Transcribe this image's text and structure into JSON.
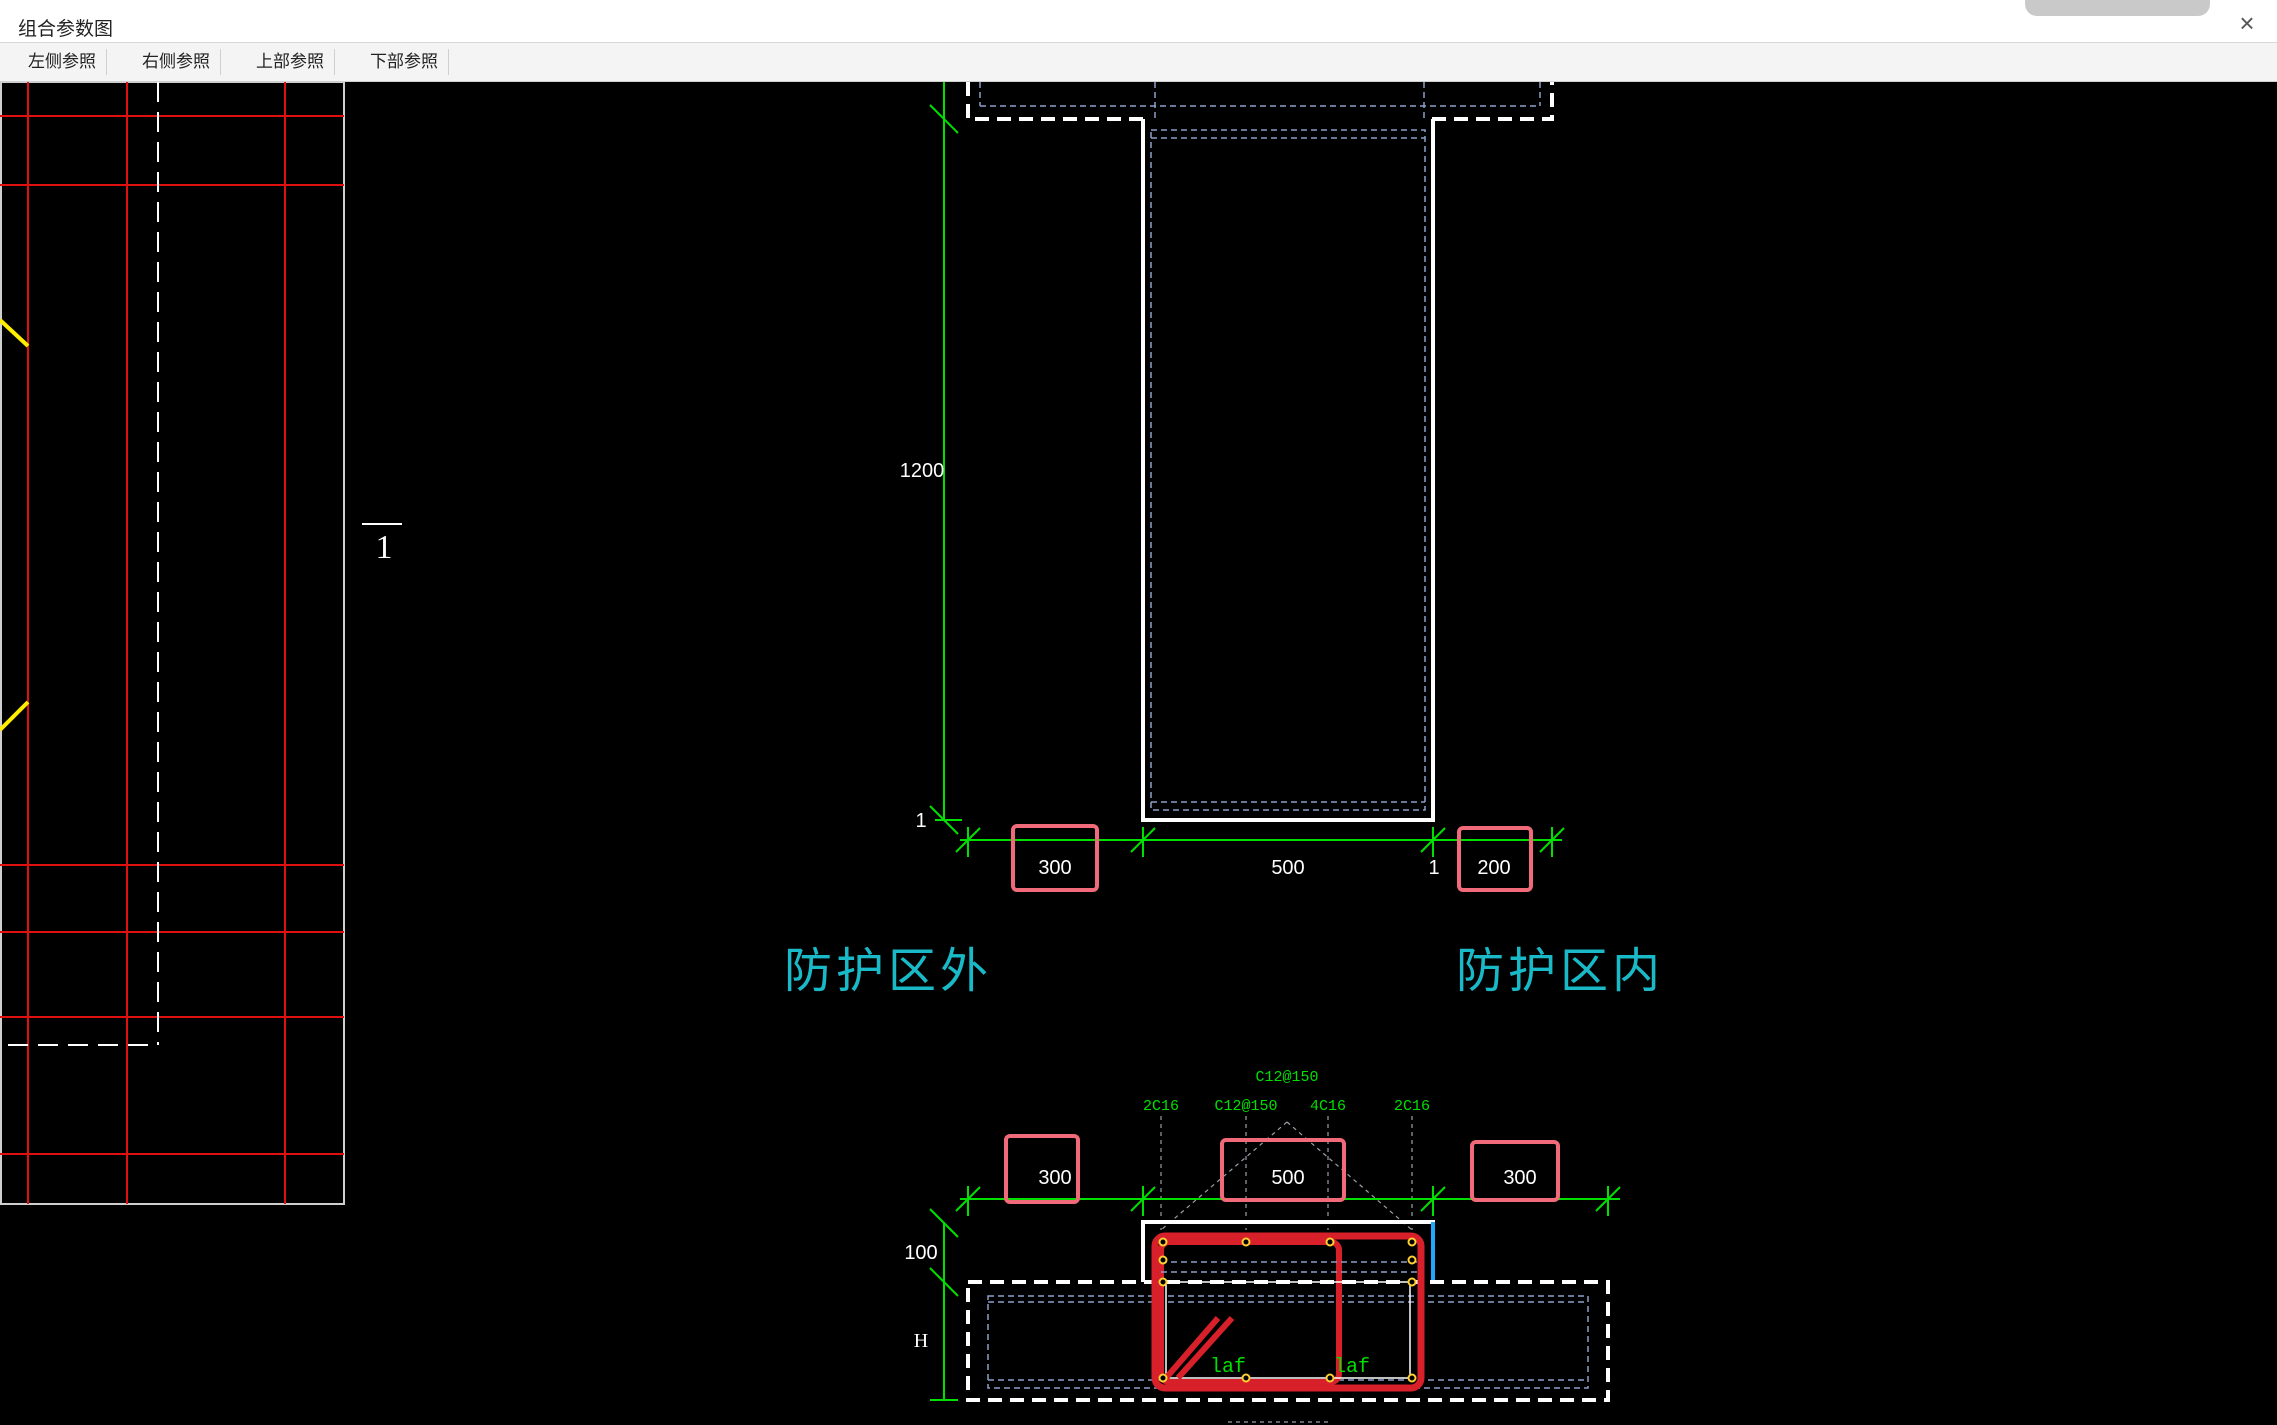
{
  "window": {
    "title": "组合参数图",
    "close_label": "×"
  },
  "toolbar": {
    "buttons": [
      "左侧参照",
      "右侧参照",
      "上部参照",
      "下部参照"
    ]
  },
  "drawing": {
    "section_mark": "1",
    "elevation": {
      "height_dim": "1200",
      "bottom_mark": "1",
      "right_mark": "1",
      "dim_left": "300",
      "dim_middle": "500",
      "dim_right": "200"
    },
    "zone_outside": "防护区外",
    "zone_inside": "防护区内",
    "section": {
      "rebar_top": "C12@150",
      "rebar_1": "2C16",
      "rebar_2": "C12@150",
      "rebar_3": "4C16",
      "rebar_4": "2C16",
      "dim_left": "300",
      "dim_middle": "500",
      "dim_right": "300",
      "dim_100": "100",
      "dim_h": "H",
      "laf_left": "laf",
      "laf_right": "laf"
    }
  },
  "colors": {
    "background": "#000000",
    "dimension": "#00e000",
    "highlight_box": "#f06a7a",
    "zone_text": "#19b9c8",
    "grid_red": "#e01010",
    "rebar_red": "#d8202a"
  }
}
